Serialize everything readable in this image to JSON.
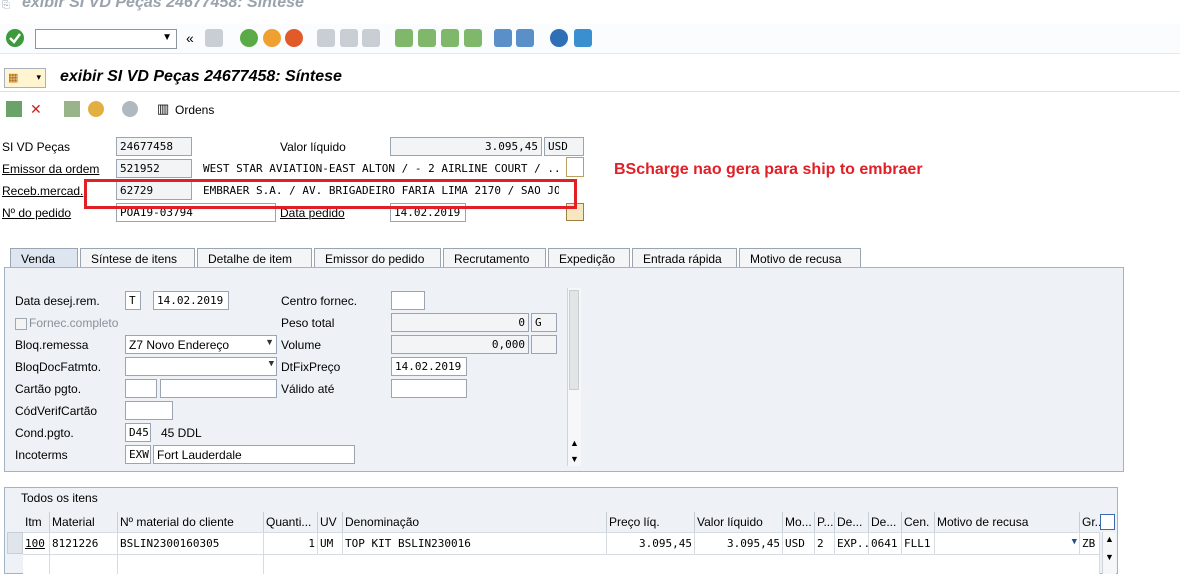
{
  "window": {
    "title": "exibir SI VD Peças 24677458: Síntese"
  },
  "header": {
    "title": "exibir SI VD Peças 24677458: Síntese"
  },
  "app_toolbar": {
    "orders_label": "Ordens"
  },
  "fields": {
    "si_label": "SI VD Peças",
    "si_value": "24677458",
    "net_value_label": "Valor líquido",
    "net_value": "3.095,45",
    "currency": "USD",
    "sold_to_label": "Emissor da ordem",
    "sold_to_id": "521952",
    "sold_to_name": "WEST STAR AVIATION-EAST ALTON / - 2 AIRLINE COURT / ...",
    "ship_to_label": "Receb.mercad.",
    "ship_to_id": "62729",
    "ship_to_name": "EMBRAER S.A. / AV. BRIGADEIRO FARIA LIMA 2170 / SAO JO...",
    "po_label": "Nº do pedido",
    "po_value": "POA19-03794",
    "po_date_label": "Data pedido",
    "po_date": "14.02.2019"
  },
  "annotation": {
    "text": "BScharge nao gera para ship to embraer",
    "color": "#e21f26"
  },
  "tabs": [
    "Venda",
    "Síntese de itens",
    "Detalhe de item",
    "Emissor do pedido",
    "Recrutamento",
    "Expedição",
    "Entrada rápida",
    "Motivo de recusa"
  ],
  "sales": {
    "req_deliv_date_label": "Data desej.rem.",
    "req_deliv_type": "T",
    "req_deliv_date": "14.02.2019",
    "plant_label": "Centro fornec.",
    "complete_label": "Fornec.completo",
    "weight_label": "Peso total",
    "weight_value": "0",
    "weight_unit": "G",
    "deliv_block_label": "Bloq.remessa",
    "deliv_block_value": "Z7 Novo Endereço",
    "volume_label": "Volume",
    "volume_value": "0,000",
    "bill_block_label": "BloqDocFatmto.",
    "pricing_date_label": "DtFixPreço",
    "pricing_date": "14.02.2019",
    "card_label": "Cartão pgto.",
    "valid_to_label": "Válido até",
    "verif_label": "CódVerifCartão",
    "payment_label": "Cond.pgto.",
    "payment_code": "D45",
    "payment_text": "45 DDL",
    "incoterms_label": "Incoterms",
    "incoterms_code": "EXW",
    "incoterms_place": "Fort Lauderdale"
  },
  "items": {
    "title": "Todos os itens",
    "columns": [
      "Itm",
      "Material",
      "Nº material do cliente",
      "Quanti...",
      "UV",
      "Denominação",
      "Preço líq.",
      "Valor líquido",
      "Mo...",
      "P...",
      "De...",
      "De...",
      "Cen.",
      "Motivo de recusa",
      "Gr..."
    ],
    "rows": [
      [
        "100",
        "8121226",
        "BSLIN2300160305",
        "1",
        "UM",
        "TOP KIT BSLIN230016",
        "3.095,45",
        "3.095,45",
        "USD",
        "2",
        "EXP...",
        "0641",
        "FLL1",
        "",
        "ZB"
      ]
    ]
  }
}
